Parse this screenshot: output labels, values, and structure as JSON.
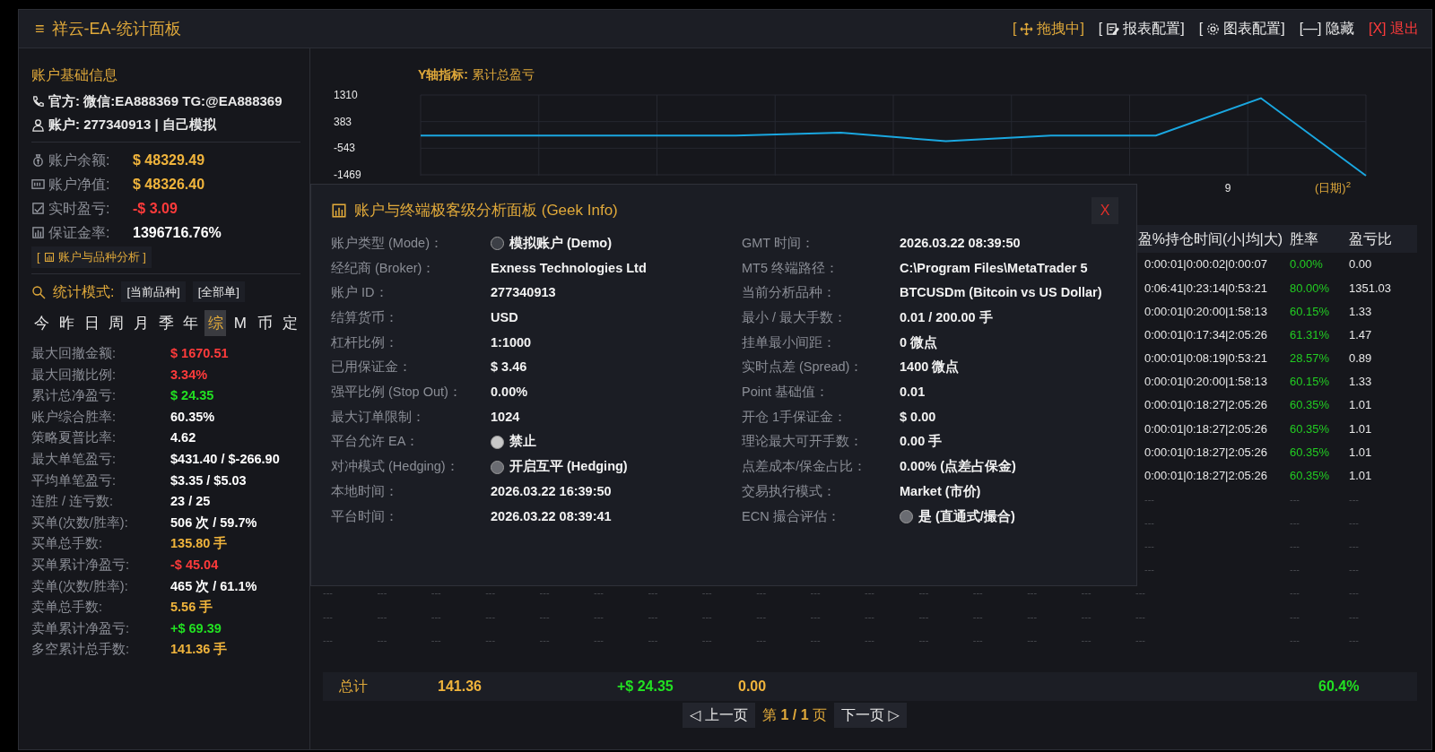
{
  "title_bar": {
    "menu_glyph": "≡",
    "title": "祥云-EA-统计面板",
    "actions": [
      {
        "prefix": "[",
        "label": "拖拽中]",
        "color": "#e0a93a"
      },
      {
        "prefix": "[",
        "label": "报表配置]",
        "color": "#e8e8e8"
      },
      {
        "prefix": "[",
        "label": "图表配置]",
        "color": "#e8e8e8"
      },
      {
        "label": "[—] 隐藏",
        "color": "#e8e8e8"
      },
      {
        "label": "[X] 退出",
        "color": "#ff3b3b"
      }
    ]
  },
  "sidebar": {
    "heading": "账户基础信息",
    "contact": "官方: 微信:EA888369 TG:@EA888369",
    "account": "账户: 277340913 | 自己模拟",
    "balances": [
      {
        "label": "账户余额:",
        "value": "$ 48329.49",
        "color": "#f0b43c"
      },
      {
        "label": "账户净值:",
        "value": "$ 48326.40",
        "color": "#f0b43c"
      },
      {
        "label": "实时盈亏:",
        "value": "-$ 3.09",
        "color": "#ff3b3b"
      },
      {
        "label": "保证金率:",
        "value": "1396716.76%",
        "color": "#ffffff"
      }
    ],
    "analysis_button": {
      "open": "[",
      "label": "账户与品种分析 ]"
    },
    "mode": {
      "label": "统计模式:",
      "options": [
        {
          "label": "[当前品种]"
        },
        {
          "label": "[全部单]"
        }
      ]
    },
    "periods": [
      {
        "label": "今",
        "selected": false
      },
      {
        "label": "昨",
        "selected": false
      },
      {
        "label": "日",
        "selected": false
      },
      {
        "label": "周",
        "selected": false
      },
      {
        "label": "月",
        "selected": false
      },
      {
        "label": "季",
        "selected": false
      },
      {
        "label": "年",
        "selected": false
      },
      {
        "label": "综",
        "selected": true
      },
      {
        "label": "M",
        "selected": false
      },
      {
        "label": "币",
        "selected": false
      },
      {
        "label": "定",
        "selected": false
      }
    ],
    "stats": [
      {
        "label": "最大回撤金额:",
        "value": "$ 1670.51",
        "color": "#ff3b3b"
      },
      {
        "label": "最大回撤比例:",
        "value": "3.34%",
        "color": "#ff3b3b"
      },
      {
        "label": "累计总净盈亏:",
        "value": "$ 24.35",
        "color": "#22e022"
      },
      {
        "label": "账户综合胜率:",
        "value": "60.35%",
        "color": "#ffffff"
      },
      {
        "label": "策略夏普比率:",
        "value": "4.62",
        "color": "#ffffff"
      },
      {
        "label": "最大单笔盈亏:",
        "value": "$431.40 / $-266.90",
        "color": "#ffffff"
      },
      {
        "label": "平均单笔盈亏:",
        "value": "$3.35 / $5.03",
        "color": "#ffffff"
      },
      {
        "label": "连胜 / 连亏数:",
        "value": "23 / 25",
        "color": "#ffffff"
      },
      {
        "label": "买单(次数/胜率):",
        "value": "506 次 / 59.7%",
        "color": "#ffffff"
      },
      {
        "label": "买单总手数:",
        "value": "135.80 手",
        "color": "#f0b43c"
      },
      {
        "label": "买单累计净盈亏:",
        "value": "-$ 45.04",
        "color": "#ff3b3b"
      },
      {
        "label": "卖单(次数/胜率):",
        "value": "465 次 / 61.1%",
        "color": "#ffffff"
      },
      {
        "label": "卖单总手数:",
        "value": "5.56 手",
        "color": "#f0b43c"
      },
      {
        "label": "卖单累计净盈亏:",
        "value": "+$ 69.39",
        "color": "#22e022"
      },
      {
        "label": "多空累计总手数:",
        "value": "141.36 手",
        "color": "#f0b43c"
      }
    ]
  },
  "chart": {
    "chart_data": {
      "type": "line",
      "title": "**Y轴指标:** 累计总盈亏",
      "xlabel": "(日期)$^{2}$",
      "series": [
        {
          "color": "#1aa7e0",
          "values": [
            -100,
            -100,
            -100,
            -100,
            0,
            -300,
            -100,
            -100,
            1200,
            -1500
          ]
        }
      ],
      "ylim": [
        -1500,
        1310
      ],
      "yticks": [
        1310,
        383,
        -543,
        -1469
      ]
    },
    "axis_marks": [
      "9"
    ]
  },
  "table": {
    "columns": [
      "盈%持仓时间(小|均|大)",
      "胜率",
      "盈亏比"
    ],
    "rows": [
      {
        "cells": [
          "0:00:01|0:00:02|0:00:07",
          "0.00%",
          "0.00"
        ]
      },
      {
        "cells": [
          "0:06:41|0:23:14|0:53:21",
          "80.00%",
          "1351.03"
        ]
      },
      {
        "cells": [
          "0:00:01|0:20:00|1:58:13",
          "60.15%",
          "1.33"
        ]
      },
      {
        "cells": [
          "0:00:01|0:17:34|2:05:26",
          "61.31%",
          "1.47"
        ]
      },
      {
        "cells": [
          "0:00:01|0:08:19|0:53:21",
          "28.57%",
          "0.89"
        ]
      },
      {
        "cells": [
          "0:00:01|0:20:00|1:58:13",
          "60.15%",
          "1.33"
        ]
      },
      {
        "cells": [
          "0:00:01|0:18:27|2:05:26",
          "60.35%",
          "1.01"
        ]
      },
      {
        "cells": [
          "0:00:01|0:18:27|2:05:26",
          "60.35%",
          "1.01"
        ]
      },
      {
        "cells": [
          "0:00:01|0:18:27|2:05:26",
          "60.35%",
          "1.01"
        ]
      },
      {
        "cells": [
          "0:00:01|0:18:27|2:05:26",
          "60.35%",
          "1.01"
        ]
      }
    ],
    "empty_rows": [
      [
        "---",
        "---",
        "---"
      ],
      [
        "---",
        "---",
        "---"
      ],
      [
        "---",
        "---",
        "---"
      ],
      [
        "---",
        "---",
        "---"
      ],
      [
        "---",
        "---",
        "---",
        "---",
        "---",
        "---",
        "---",
        "---",
        "---",
        "---",
        "---",
        "---",
        "---",
        "---",
        "---",
        "---",
        "---",
        "---"
      ],
      [
        "---",
        "---",
        "---",
        "---",
        "---",
        "---",
        "---",
        "---",
        "---",
        "---",
        "---",
        "---",
        "---",
        "---",
        "---",
        "---",
        "---",
        "---"
      ],
      [
        "---",
        "---",
        "---",
        "---",
        "---",
        "---",
        "---",
        "---",
        "---",
        "---",
        "---",
        "---",
        "---",
        "---",
        "---",
        "---",
        "---",
        "---"
      ]
    ],
    "totals": [
      {
        "text": "总计",
        "color": "#e0a93a"
      },
      {
        "text": "141.36",
        "color": "#f0b43c"
      },
      {
        "text": "+$ 24.35",
        "color": "#22e022"
      },
      {
        "text": "0.00",
        "color": "#f0b43c"
      },
      {
        "text": "60.4%",
        "color": "#22e022"
      }
    ],
    "pagination": {
      "prev": "◁ 上一页",
      "page": "第 **1 / 1** 页",
      "next": "下一页 ▷"
    }
  },
  "dialog": {
    "title": "账户与终端极客级分析面板 (Geek Info)",
    "close": "X",
    "left": [
      {
        "label": "账户类型 (Mode)：",
        "value": "模拟账户 (Demo)",
        "kind": "status",
        "color": "#3c3f46"
      },
      {
        "label": "经纪商 (Broker)：",
        "value": "Exness Technologies Ltd",
        "kind": "text"
      },
      {
        "label": "账户 ID：",
        "value": "277340913",
        "kind": "text"
      },
      {
        "label": "结算货币：",
        "value": "USD",
        "kind": "text"
      },
      {
        "label": "杠杆比例：",
        "value": "1:1000",
        "kind": "text"
      },
      {
        "label": "已用保证金：",
        "value": "$ 3.46",
        "kind": "text"
      },
      {
        "label": "强平比例 (Stop Out)：",
        "value": "0.00%",
        "kind": "text"
      },
      {
        "label": "最大订单限制：",
        "value": "1024",
        "kind": "text"
      },
      {
        "label": "平台允许 EA：",
        "value": "禁止",
        "kind": "status",
        "color": "#c8c8c8"
      },
      {
        "label": "对冲模式 (Hedging)：",
        "value": "开启互平 (Hedging)",
        "kind": "status",
        "color": "#6a6c72"
      },
      {
        "label": "本地时间：",
        "value": "2026.03.22 16:39:50",
        "kind": "text"
      },
      {
        "label": "平台时间：",
        "value": "2026.03.22 08:39:41",
        "kind": "text"
      }
    ],
    "right": [
      {
        "label": "GMT 时间：",
        "value": "2026.03.22 08:39:50",
        "kind": "text"
      },
      {
        "label": "MT5 终端路径：",
        "value": "C:\\Program Files\\MetaTrader 5",
        "kind": "text"
      },
      {
        "label": "当前分析品种：",
        "value": "BTCUSDm (Bitcoin vs US Dollar)",
        "kind": "text"
      },
      {
        "label": "最小 / 最大手数：",
        "value": "0.01 / 200.00 手",
        "kind": "text"
      },
      {
        "label": "挂单最小间距：",
        "value": "0 微点",
        "kind": "text"
      },
      {
        "label": "实时点差 (Spread)：",
        "value": "1400 微点",
        "kind": "text"
      },
      {
        "label": "Point 基础值：",
        "value": "0.01",
        "kind": "text"
      },
      {
        "label": "开仓 1手保证金：",
        "value": "$ 0.00",
        "kind": "text"
      },
      {
        "label": "理论最大可开手数：",
        "value": "0.00 手",
        "kind": "text"
      },
      {
        "label": "点差成本/保金占比：",
        "value": "0.00% (点差占保金)",
        "kind": "text"
      },
      {
        "label": "交易执行模式：",
        "value": "Market (市价)",
        "kind": "text"
      },
      {
        "label": "ECN 撮合评估：",
        "value": "是 (直通式/撮合)",
        "kind": "status",
        "color": "#6a6c72"
      }
    ]
  }
}
